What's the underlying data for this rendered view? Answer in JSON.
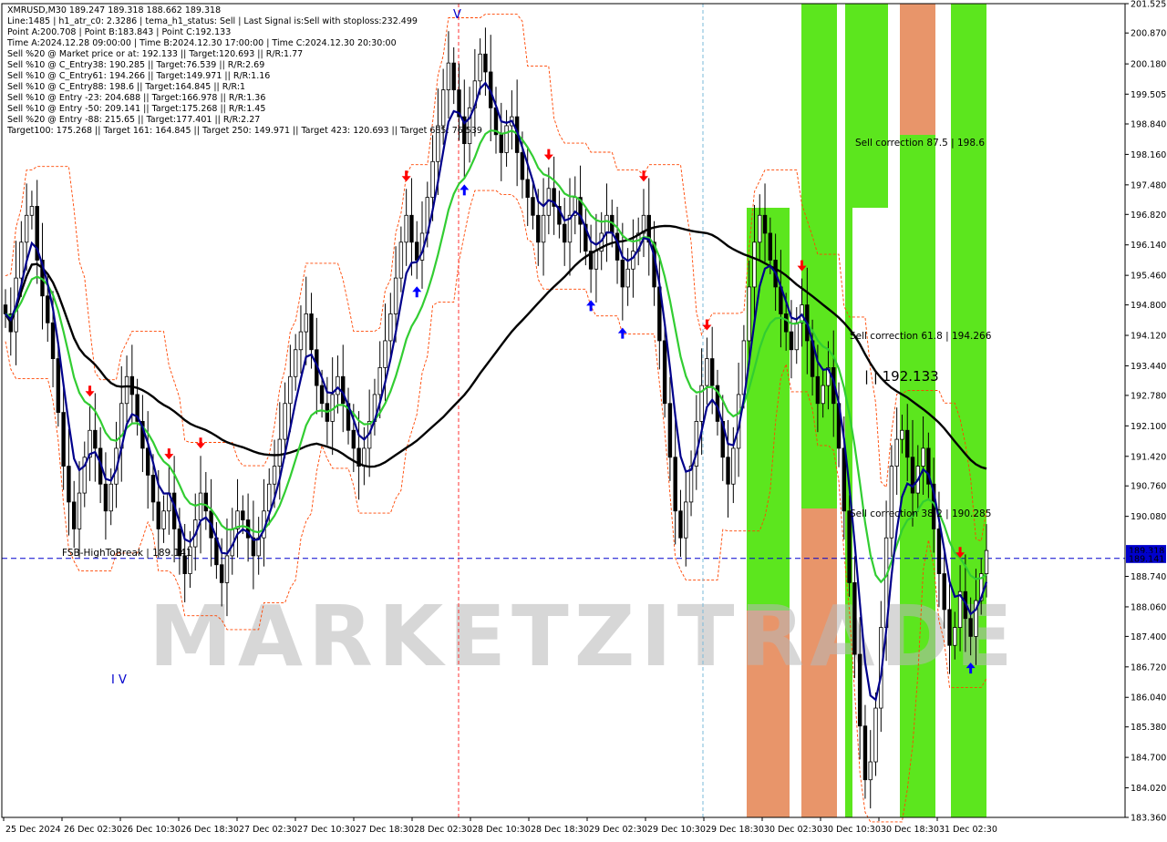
{
  "header": {
    "lines": [
      "XMRUSD,M30  189.247 189.318 188.662 189.318",
      "Line:1485  | h1_atr_c0: 2.3286  | tema_h1_status: Sell  | Last Signal is:Sell with stoploss:232.499",
      "Point A:200.708  | Point B:183.843  | Point C:192.133",
      "Time A:2024.12.28 09:00:00  | Time B:2024.12.30 17:00:00  | Time C:2024.12.30 20:30:00",
      "Sell %20 @ Market price or at: 192.133  || Target:120.693  || R/R:1.77",
      "Sell %10 @ C_Entry38: 190.285  || Target:76.539  || R/R:2.69",
      "Sell %10 @ C_Entry61: 194.266  || Target:149.971  || R/R:1.16",
      "Sell %10 @ C_Entry88: 198.6  || Target:164.845  || R/R:1",
      "Sell %10 @ Entry -23: 204.688  || Target:166.978  || R/R:1.36",
      "Sell %10 @ Entry -50: 209.141  || Target:175.268  || R/R:1.45",
      "Sell %20 @ Entry -88: 215.65  || Target:177.401  || R/R:2.27",
      "Target100: 175.268  || Target 161: 164.845  || Target 250: 149.971  || Target 423: 120.693  || Target 685: 76.539"
    ]
  },
  "annotations": {
    "fsb": "FSB-HighToBreak | 189.141",
    "sell_corr_875": "Sell correction 87.5 | 198.6",
    "sell_corr_618": "Sell correction 61.8 | 194.266",
    "sell_corr_382": "Sell correction 38.2 | 190.285",
    "point_c_label": "| | 192.133",
    "wave_iv": "I V",
    "wave_v": "V",
    "watermark": "MARKETZITRADE"
  },
  "colors": {
    "background": "#ffffff",
    "candle": "#000000",
    "tema_line": "#00008b",
    "ma_green": "#32cd32",
    "ma_black": "#000000",
    "zone_green": "#5ce61e",
    "zone_orange": "#e8956a",
    "up_arrow": "#0000ff",
    "down_arrow": "#ff0000",
    "channel": "#ff4500",
    "price_tag_bg": "#0000cd",
    "hline": "#0000cd"
  },
  "chart_data": {
    "type": "candlestick",
    "symbol": "XMRUSD",
    "timeframe": "M30",
    "ylim": [
      183.36,
      201.525
    ],
    "y_ticks": [
      "201.525",
      "200.870",
      "200.180",
      "199.505",
      "198.840",
      "198.160",
      "197.480",
      "196.820",
      "196.140",
      "195.460",
      "194.800",
      "194.120",
      "193.440",
      "192.780",
      "192.100",
      "191.420",
      "190.760",
      "190.080",
      "189.318",
      "189.141",
      "188.740",
      "188.060",
      "187.400",
      "186.720",
      "186.040",
      "185.380",
      "184.700",
      "184.020",
      "183.360"
    ],
    "x_ticks": [
      "25 Dec 2024",
      "26 Dec 02:30",
      "26 Dec 10:30",
      "26 Dec 18:30",
      "27 Dec 02:30",
      "27 Dec 10:30",
      "27 Dec 18:30",
      "28 Dec 02:30",
      "28 Dec 10:30",
      "28 Dec 18:30",
      "29 Dec 02:30",
      "29 Dec 10:30",
      "29 Dec 18:30",
      "30 Dec 02:30",
      "30 Dec 10:30",
      "30 Dec 18:30",
      "31 Dec 02:30"
    ],
    "current_price": 189.318,
    "hline_price": 189.141,
    "closes": [
      194.6,
      194.2,
      195.4,
      196.2,
      196.8,
      197.0,
      195.8,
      195.0,
      194.4,
      193.6,
      192.4,
      191.2,
      190.4,
      189.8,
      190.6,
      191.4,
      192.0,
      191.6,
      190.8,
      190.2,
      190.8,
      191.6,
      192.6,
      193.2,
      192.8,
      192.2,
      191.6,
      191.0,
      190.4,
      189.8,
      190.2,
      190.6,
      189.8,
      189.2,
      188.8,
      189.4,
      190.0,
      190.6,
      190.2,
      189.6,
      189.0,
      188.6,
      189.2,
      189.8,
      190.2,
      190.0,
      189.6,
      189.2,
      189.6,
      190.2,
      190.8,
      191.2,
      191.8,
      192.6,
      193.2,
      193.8,
      194.2,
      194.6,
      193.8,
      193.0,
      192.6,
      192.2,
      192.8,
      193.2,
      192.6,
      192.0,
      191.6,
      191.2,
      191.6,
      192.2,
      192.8,
      193.4,
      194.0,
      194.6,
      195.4,
      196.2,
      196.8,
      196.2,
      195.8,
      196.4,
      197.2,
      198.0,
      198.8,
      199.6,
      200.2,
      199.6,
      199.0,
      198.4,
      199.2,
      199.8,
      200.4,
      200.0,
      199.2,
      198.6,
      198.2,
      198.8,
      199.0,
      198.2,
      197.6,
      197.2,
      196.8,
      196.2,
      196.8,
      197.4,
      197.0,
      196.6,
      196.2,
      196.8,
      197.2,
      196.6,
      196.0,
      195.6,
      196.0,
      196.4,
      196.8,
      196.4,
      195.8,
      195.2,
      195.6,
      196.0,
      196.4,
      196.8,
      196.2,
      195.2,
      194.0,
      192.6,
      191.4,
      190.2,
      189.6,
      190.4,
      191.2,
      192.2,
      193.0,
      193.6,
      193.0,
      192.2,
      191.4,
      190.8,
      191.6,
      192.8,
      194.0,
      195.2,
      196.2,
      196.8,
      196.4,
      195.8,
      195.2,
      194.6,
      194.2,
      193.8,
      194.4,
      194.8,
      194.0,
      193.2,
      192.6,
      193.0,
      193.4,
      192.6,
      191.6,
      190.2,
      188.6,
      187.0,
      185.4,
      184.2,
      184.6,
      185.8,
      187.6,
      189.6,
      191.2,
      191.8,
      192.0,
      191.4,
      190.6,
      191.2,
      191.6,
      190.8,
      189.8,
      188.8,
      188.0,
      187.2,
      187.6,
      188.4,
      187.8,
      187.4,
      188.2,
      188.8,
      189.318
    ]
  }
}
